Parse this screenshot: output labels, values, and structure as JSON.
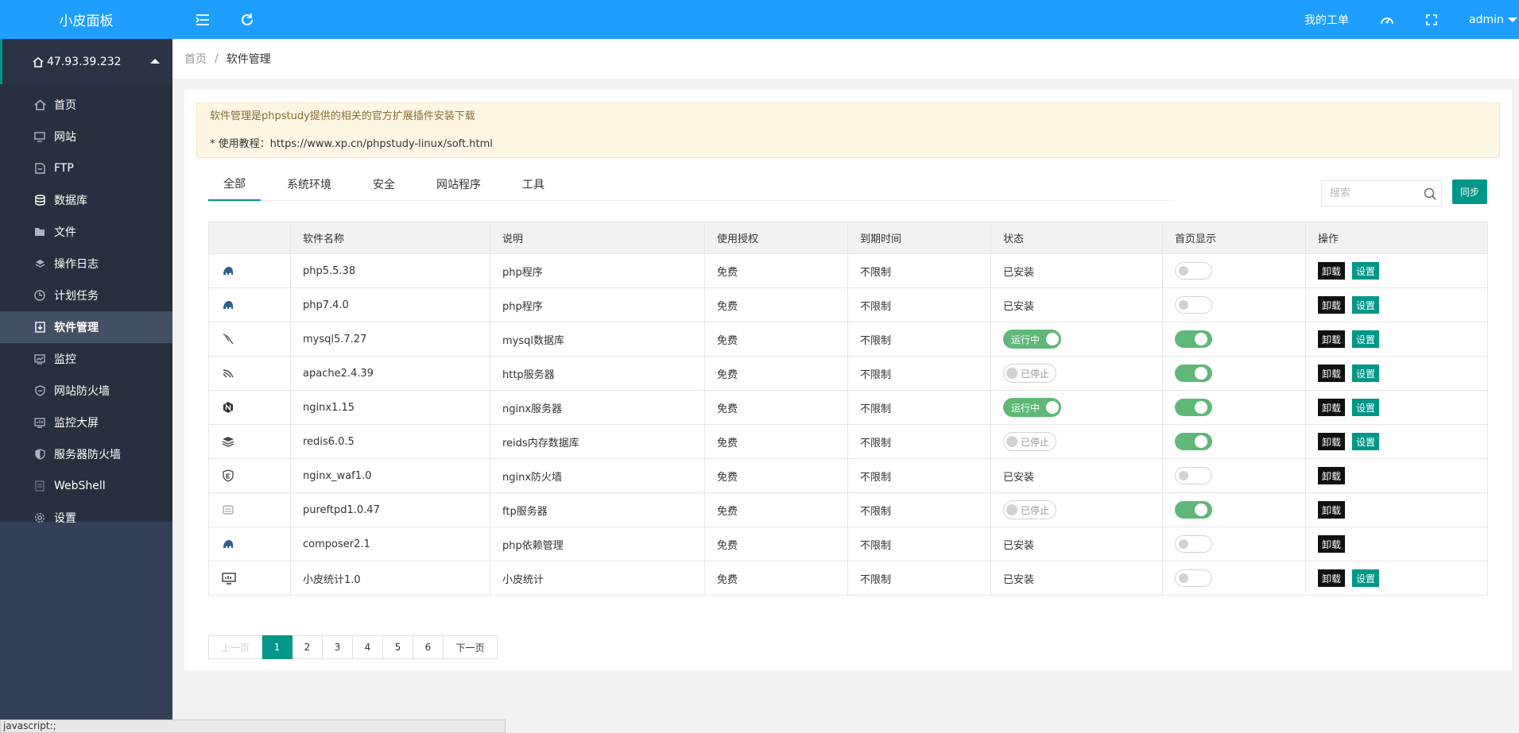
{
  "app": {
    "title": "小皮面板"
  },
  "topbar": {
    "my_ticket": "我的工单",
    "user": "admin",
    "icons": [
      "menu-fold-icon",
      "refresh-icon",
      "theme-icon",
      "fullscreen-icon"
    ]
  },
  "sidebar": {
    "server": "47.93.39.232",
    "items": [
      {
        "label": "首页",
        "icon": "home-icon"
      },
      {
        "label": "网站",
        "icon": "monitor-icon"
      },
      {
        "label": "FTP",
        "icon": "ftp-icon"
      },
      {
        "label": "数据库",
        "icon": "database-icon"
      },
      {
        "label": "文件",
        "icon": "folder-icon"
      },
      {
        "label": "操作日志",
        "icon": "layers-icon"
      },
      {
        "label": "计划任务",
        "icon": "clock-icon"
      },
      {
        "label": "软件管理",
        "icon": "download-box-icon",
        "active": true
      },
      {
        "label": "监控",
        "icon": "chart-icon"
      },
      {
        "label": "网站防火墙",
        "icon": "shield-icon"
      },
      {
        "label": "监控大屏",
        "icon": "screen-icon"
      },
      {
        "label": "服务器防火墙",
        "icon": "shield-half-icon"
      },
      {
        "label": "WebShell",
        "icon": "webshell-icon"
      },
      {
        "label": "设置",
        "icon": "gear-icon"
      }
    ]
  },
  "breadcrumb": {
    "home": "首页",
    "sep": "/",
    "current": "软件管理"
  },
  "notice": {
    "line1": "软件管理是phpstudy提供的相关的官方扩展插件安装下载",
    "line2": "* 使用教程：https://www.xp.cn/phpstudy-linux/soft.html"
  },
  "tabs": [
    "全部",
    "系统环境",
    "安全",
    "网站程序",
    "工具"
  ],
  "search": {
    "placeholder": "搜索"
  },
  "sync_label": "同步",
  "table": {
    "headers": [
      "",
      "软件名称",
      "说明",
      "使用授权",
      "到期时间",
      "状态",
      "首页显示",
      "操作"
    ],
    "rows": [
      {
        "icon": "php-icon",
        "name": "php5.5.38",
        "desc": "php程序",
        "license": "免费",
        "expire": "不限制",
        "status": "已安装",
        "status_type": "text",
        "home": false,
        "actions": [
          "卸载",
          "设置"
        ]
      },
      {
        "icon": "php-icon",
        "name": "php7.4.0",
        "desc": "php程序",
        "license": "免费",
        "expire": "不限制",
        "status": "已安装",
        "status_type": "text",
        "home": false,
        "actions": [
          "卸载",
          "设置"
        ]
      },
      {
        "icon": "mysql-icon",
        "name": "mysql5.7.27",
        "desc": "mysql数据库",
        "license": "免费",
        "expire": "不限制",
        "status": "运行中",
        "status_type": "run",
        "home": true,
        "actions": [
          "卸载",
          "设置"
        ]
      },
      {
        "icon": "apache-icon",
        "name": "apache2.4.39",
        "desc": "http服务器",
        "license": "免费",
        "expire": "不限制",
        "status": "已停止",
        "status_type": "stop",
        "home": true,
        "actions": [
          "卸载",
          "设置"
        ]
      },
      {
        "icon": "nginx-icon",
        "name": "nginx1.15",
        "desc": "nginx服务器",
        "license": "免费",
        "expire": "不限制",
        "status": "运行中",
        "status_type": "run",
        "home": true,
        "actions": [
          "卸载",
          "设置"
        ]
      },
      {
        "icon": "redis-icon",
        "name": "redis6.0.5",
        "desc": "reids内存数据库",
        "license": "免费",
        "expire": "不限制",
        "status": "已停止",
        "status_type": "stop",
        "home": true,
        "actions": [
          "卸载",
          "设置"
        ]
      },
      {
        "icon": "waf-icon",
        "name": "nginx_waf1.0",
        "desc": "nginx防火墙",
        "license": "免费",
        "expire": "不限制",
        "status": "已安装",
        "status_type": "text",
        "home": false,
        "actions": [
          "卸载"
        ]
      },
      {
        "icon": "ftp-server-icon",
        "name": "pureftpd1.0.47",
        "desc": "ftp服务器",
        "license": "免费",
        "expire": "不限制",
        "status": "已停止",
        "status_type": "stop",
        "home": true,
        "actions": [
          "卸载"
        ]
      },
      {
        "icon": "php-icon",
        "name": "composer2.1",
        "desc": "php依赖管理",
        "license": "免费",
        "expire": "不限制",
        "status": "已安装",
        "status_type": "text",
        "home": false,
        "actions": [
          "卸载"
        ]
      },
      {
        "icon": "stats-icon",
        "name": "小皮统计1.0",
        "desc": "小皮统计",
        "license": "免费",
        "expire": "不限制",
        "status": "已安装",
        "status_type": "text",
        "home": false,
        "actions": [
          "卸载",
          "设置"
        ]
      }
    ]
  },
  "pager": {
    "prev": "上一页",
    "pages": [
      "1",
      "2",
      "3",
      "4",
      "5",
      "6"
    ],
    "current": "1",
    "next": "下一页"
  },
  "statusbar": "javascript:;",
  "colors": {
    "topbar": "#1e9fff",
    "sidebar": "#28303f",
    "accent": "#009688",
    "switch_on": "#5fb878"
  }
}
